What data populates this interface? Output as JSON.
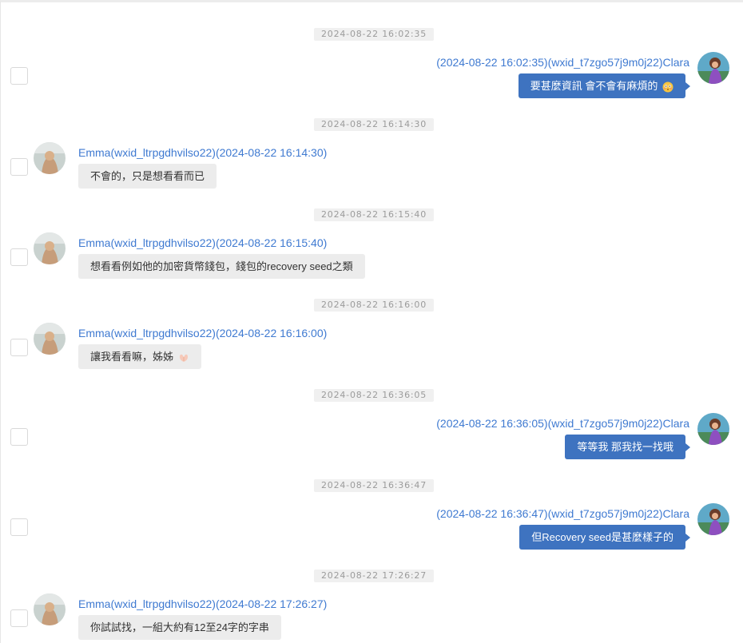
{
  "messages": [
    {
      "timestamp": "2024-08-22 16:02:35",
      "direction": "out",
      "sender_line": "(2024-08-22 16:02:35)(wxid_t7zgo57j9m0j22)Clara",
      "text": "要甚麼資訊 會不會有麻煩的",
      "emoji": "flushed-face-icon"
    },
    {
      "timestamp": "2024-08-22 16:14:30",
      "direction": "in",
      "sender_line": "Emma(wxid_ltrpgdhvilso22)(2024-08-22 16:14:30)",
      "text": "不會的，只是想看看而已"
    },
    {
      "timestamp": "2024-08-22 16:15:40",
      "direction": "in",
      "sender_line": "Emma(wxid_ltrpgdhvilso22)(2024-08-22 16:15:40)",
      "text": "想看看例如他的加密貨幣錢包，錢包的recovery seed之類"
    },
    {
      "timestamp": "2024-08-22 16:16:00",
      "direction": "in",
      "sender_line": "Emma(wxid_ltrpgdhvilso22)(2024-08-22 16:16:00)",
      "text": "讓我看看嘛，姊姊",
      "emoji": "pleading-hands-icon"
    },
    {
      "timestamp": "2024-08-22 16:36:05",
      "direction": "out",
      "sender_line": "(2024-08-22 16:36:05)(wxid_t7zgo57j9m0j22)Clara",
      "text": "等等我 那我找一找哦"
    },
    {
      "timestamp": "2024-08-22 16:36:47",
      "direction": "out",
      "sender_line": "(2024-08-22 16:36:47)(wxid_t7zgo57j9m0j22)Clara",
      "text": "但Recovery seed是甚麼樣子的"
    },
    {
      "timestamp": "2024-08-22 17:26:27",
      "direction": "in",
      "sender_line": "Emma(wxid_ltrpgdhvilso22)(2024-08-22 17:26:27)",
      "text": "你試試找，一組大約有12至24字的字串"
    }
  ],
  "colors": {
    "outgoing_bubble": "#3e73c0",
    "incoming_bubble": "#ececec",
    "sender_text": "#3f7ad1",
    "timestamp_text": "#9b9b9b"
  }
}
